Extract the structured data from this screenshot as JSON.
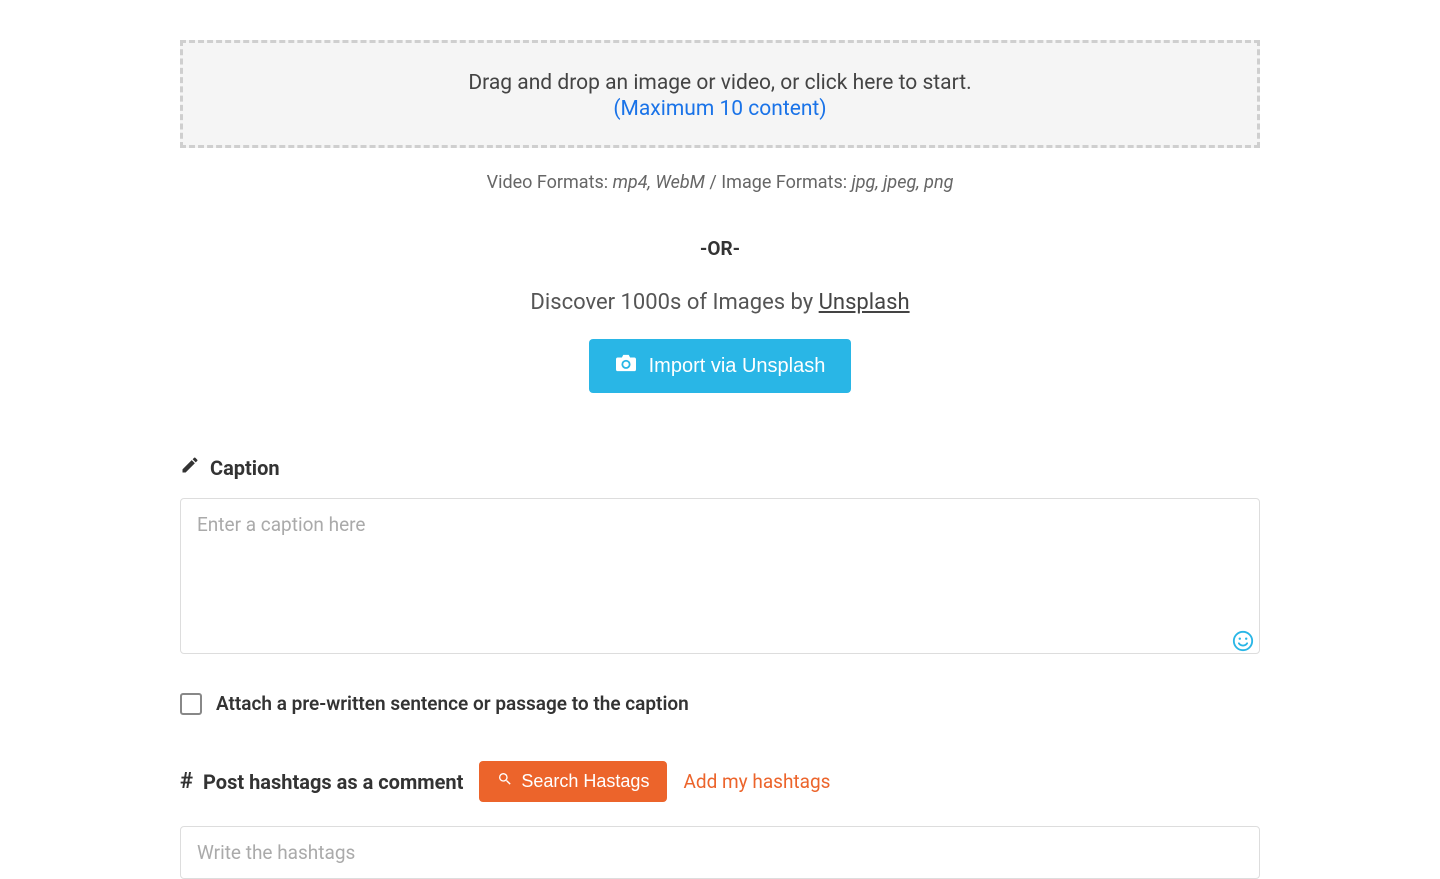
{
  "dropzone": {
    "line1": "Drag and drop an image or video, or click here to start.",
    "line2": "(Maximum 10 content)"
  },
  "formats": {
    "video_label": "Video Formats: ",
    "video_values": "mp4, WebM",
    "separator": " / ",
    "image_label": "Image Formats: ",
    "image_values": "jpg, jpeg, png"
  },
  "or_text": "-OR-",
  "discover": {
    "prefix": "Discover 1000s of Images by ",
    "link": "Unsplash"
  },
  "import_button": "Import via Unsplash",
  "caption": {
    "heading": "Caption",
    "placeholder": "Enter a caption here"
  },
  "attach_label": "Attach a pre-written sentence or passage to the caption",
  "hashtags": {
    "heading": "Post hashtags as a comment",
    "search_button": "Search Hastags",
    "add_link": "Add my hashtags",
    "placeholder": "Write the hashtags"
  }
}
